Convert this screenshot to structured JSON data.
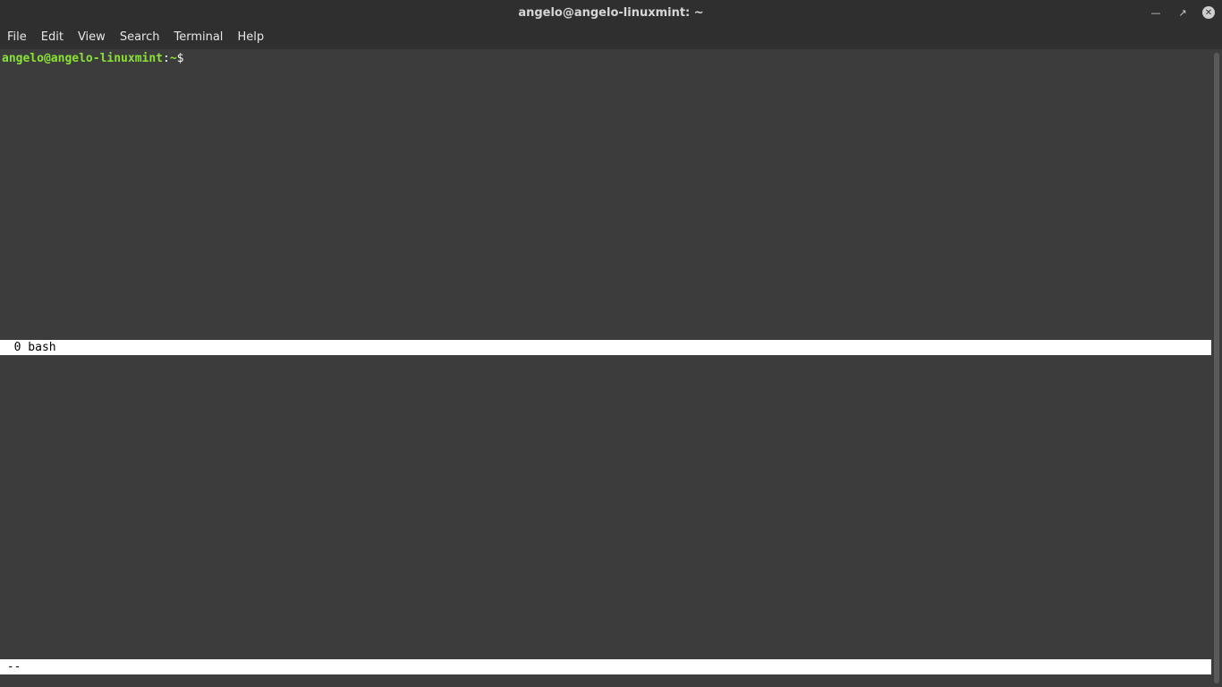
{
  "window": {
    "title": "angelo@angelo-linuxmint: ~",
    "controls": {
      "minimize_icon": "minimize-icon",
      "maximize_icon": "maximize-icon",
      "close_icon": "close-icon"
    }
  },
  "menu": {
    "items": [
      "File",
      "Edit",
      "View",
      "Search",
      "Terminal",
      "Help"
    ]
  },
  "terminal": {
    "prompt": {
      "user_host": "angelo@angelo-linuxmint",
      "separator": ":",
      "path": "~",
      "symbol": "$"
    },
    "top_status": "  0 bash",
    "bottom_status": " --"
  },
  "colors": {
    "background": "#3c3c3c",
    "titlebar": "#2f2f2f",
    "prompt_green": "#8ae234",
    "status_bar_bg": "#ffffff"
  }
}
